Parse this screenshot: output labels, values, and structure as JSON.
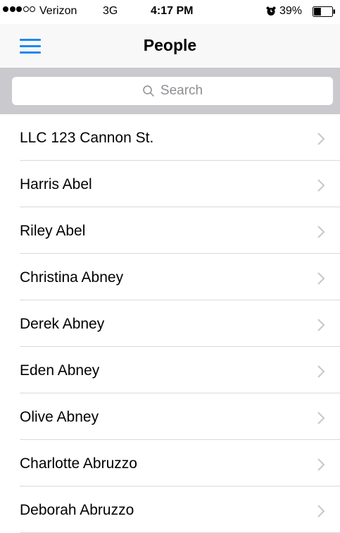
{
  "status_bar": {
    "carrier": "Verizon",
    "network": "3G",
    "time": "4:17 PM",
    "battery_percent": "39%",
    "signal_bars_filled": 3,
    "signal_bars_total": 5,
    "battery_level": 0.39
  },
  "nav": {
    "title": "People",
    "menu_icon": "hamburger-menu-icon",
    "accent_color": "#1e88f0"
  },
  "search": {
    "placeholder": "Search"
  },
  "people": [
    {
      "name": "LLC 123 Cannon St."
    },
    {
      "name": "Harris Abel"
    },
    {
      "name": "Riley Abel"
    },
    {
      "name": "Christina Abney"
    },
    {
      "name": "Derek Abney"
    },
    {
      "name": "Eden Abney"
    },
    {
      "name": "Olive Abney"
    },
    {
      "name": "Charlotte Abruzzo"
    },
    {
      "name": "Deborah Abruzzo"
    }
  ]
}
